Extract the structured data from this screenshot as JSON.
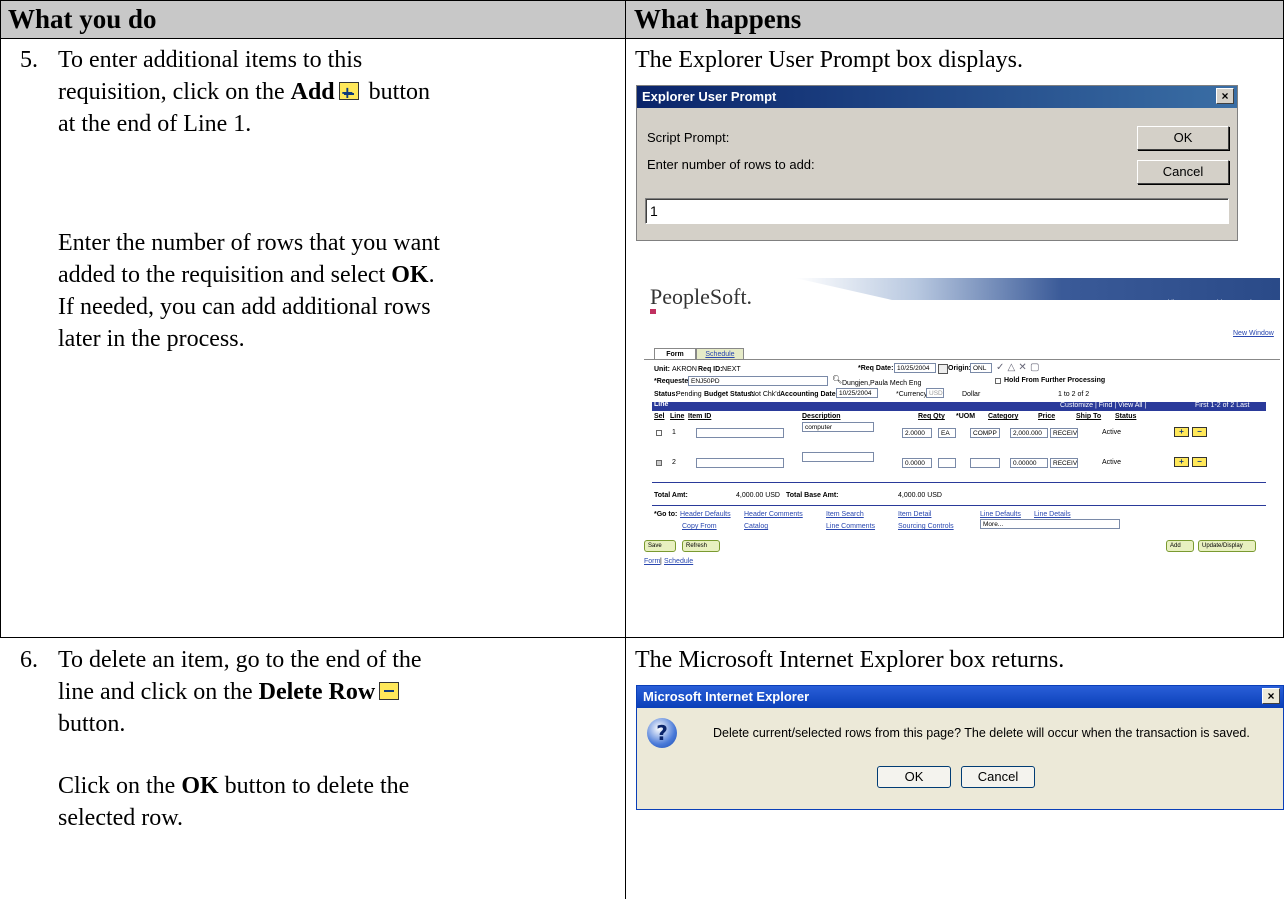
{
  "header": {
    "col1": "What you do",
    "col2": "What happens"
  },
  "step5": {
    "number": "5.",
    "line1": "To enter additional items to this",
    "line2_a": "requisition, click on the ",
    "line2_bold": "Add",
    "line2_b": " button",
    "line3": "at the end of Line 1.",
    "para2_1": "Enter the number of rows that you want",
    "para2_2a": "added to the requisition and select ",
    "para2_2bold": "OK",
    "para2_2b": ".",
    "para2_3": "If needed, you can add additional rows",
    "para2_4": "later in the process.",
    "result": "The Explorer User Prompt box displays."
  },
  "prompt_dialog": {
    "title": "Explorer User Prompt",
    "close": "×",
    "script_prompt": "Script Prompt:",
    "message": "Enter number of rows to add:",
    "ok": "OK",
    "cancel": "Cancel",
    "input_value": "1"
  },
  "peoplesoft": {
    "logo": "PeopleSoft.",
    "nav": [
      "Home",
      "Worklist",
      "Add to Favorites"
    ],
    "new_window": "New Window",
    "tabs": [
      "Form",
      "Schedule"
    ],
    "unit_label": "Unit:",
    "unit_value": "AKRON",
    "reqid_label": "Req ID:",
    "reqid_value": "NEXT",
    "reqdate_label": "*Req Date:",
    "reqdate_value": "10/25/2004",
    "origin_label": "Origin:",
    "origin_value": "ONL",
    "requester_label": "*Requester:",
    "requester_value": "ENJ50PD",
    "requester_name": "Dungjen,Paula Mech Eng",
    "hold_label": "Hold From Further Processing",
    "status_label": "Status:",
    "status_value": "Pending",
    "budget_label": "Budget Status:",
    "budget_value": "Not Chk'd",
    "acct_label": "Accounting Date:",
    "acct_value": "10/25/2004",
    "currency_label": "*Currency:",
    "currency_value": "USD",
    "currency_name": "Dollar",
    "grid_title": "Line",
    "grid_nav": "Customize | Find | View All |",
    "grid_pager": "First  1-2 of 2  Last",
    "pager_small": "1 to 2 of 2",
    "columns": [
      "Sel",
      "Line",
      "Item ID",
      "Description",
      "Req Qty",
      "*UOM",
      "Category",
      "Price",
      "Ship To",
      "Status"
    ],
    "rows": [
      {
        "line": "1",
        "item": "",
        "desc": "computer",
        "qty": "2.0000",
        "uom": "EA",
        "cat": "COMPP",
        "price": "2,000.000",
        "ship": "RECEIV",
        "status": "Active"
      },
      {
        "line": "2",
        "item": "",
        "desc": "",
        "qty": "0.0000",
        "uom": "",
        "cat": "",
        "price": "0.00000",
        "ship": "RECEIV",
        "status": "Active"
      }
    ],
    "total_label": "Total Amt:",
    "total_value": "4,000.00 USD",
    "total_base_label": "Total Base Amt:",
    "total_base_value": "4,000.00 USD",
    "goto_label": "*Go to:",
    "links": [
      "Header Defaults",
      "Header Comments",
      "Item Search",
      "Item Detail",
      "Line Defaults",
      "Line Details",
      "Copy From",
      "Catalog",
      "Line Comments",
      "Sourcing Controls"
    ],
    "more": "More...",
    "save": "Save",
    "refresh": "Refresh",
    "add": "Add",
    "update": "Update/Display",
    "footer_links": [
      "Form",
      "Schedule"
    ]
  },
  "step6": {
    "number": "6.",
    "line1": "To delete an item, go to the end of the",
    "line2_a": "line and click on the ",
    "line2_bold": "Delete Row",
    "line3": "button.",
    "para2_a": "Click on the ",
    "para2_bold": "OK",
    "para2_b": " button to delete the",
    "para2_2": "selected row.",
    "result": "The Microsoft Internet Explorer box returns."
  },
  "confirm_dialog": {
    "title": "Microsoft Internet Explorer",
    "close": "×",
    "message": "Delete current/selected rows from this page? The delete will occur when the transaction is saved.",
    "ok": "OK",
    "cancel": "Cancel"
  }
}
